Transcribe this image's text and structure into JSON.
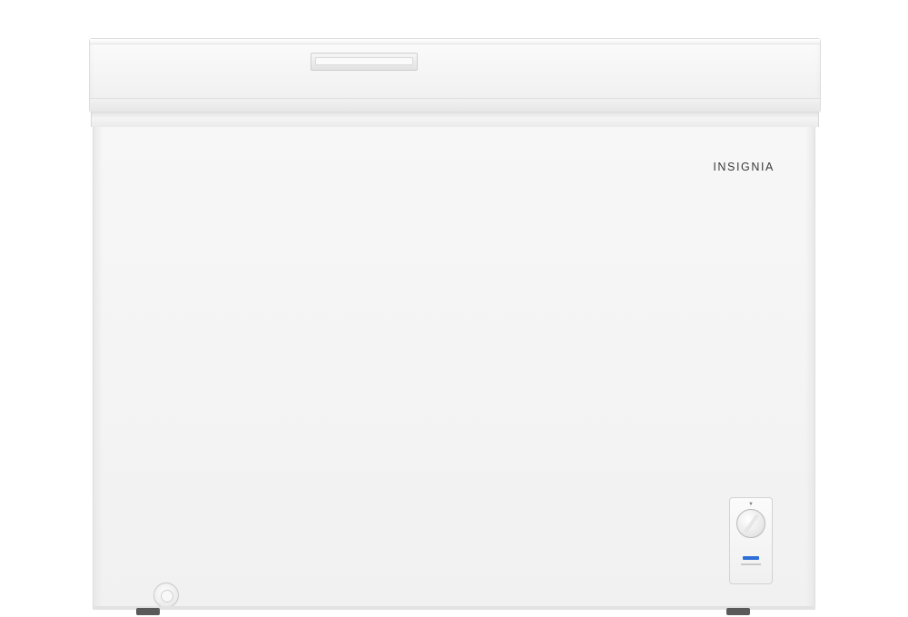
{
  "product": {
    "brand_label": "INSIGNIA",
    "color_primary": "#f4f4f4",
    "indicator_color": "#2e6ed8"
  }
}
